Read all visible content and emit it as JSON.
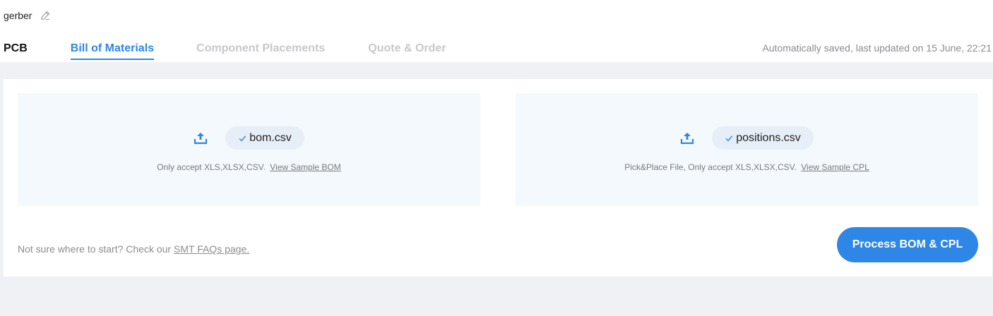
{
  "project": {
    "name": "gerber",
    "edit_icon": "pencil-icon"
  },
  "tabs": [
    {
      "label": "PCB",
      "state": "done"
    },
    {
      "label": "Bill of Materials",
      "state": "active"
    },
    {
      "label": "Component Placements",
      "state": "disabled"
    },
    {
      "label": "Quote & Order",
      "state": "disabled"
    }
  ],
  "autosave_text": "Automatically saved, last updated on 15 June, 22:21",
  "bom_upload": {
    "icon": "upload-icon",
    "file_name": "bom.csv",
    "hint": "Only accept XLS,XLSX,CSV.",
    "sample_link": "View Sample BOM"
  },
  "cpl_upload": {
    "icon": "upload-icon",
    "file_name": "positions.csv",
    "hint": "Pick&Place File, Only accept XLS,XLSX,CSV.",
    "sample_link": "View Sample CPL"
  },
  "footer": {
    "note": "Not sure where to start? Check our",
    "faq_link": "SMT FAQs page."
  },
  "process_button": "Process BOM & CPL",
  "colors": {
    "accent": "#2e87e6",
    "page_bg": "#f0f1f4",
    "upload_bg": "#f4f9fe",
    "chip_bg": "#e6eef7",
    "muted_text": "#8c8c8c",
    "disabled_tab": "#c8c8c8"
  }
}
